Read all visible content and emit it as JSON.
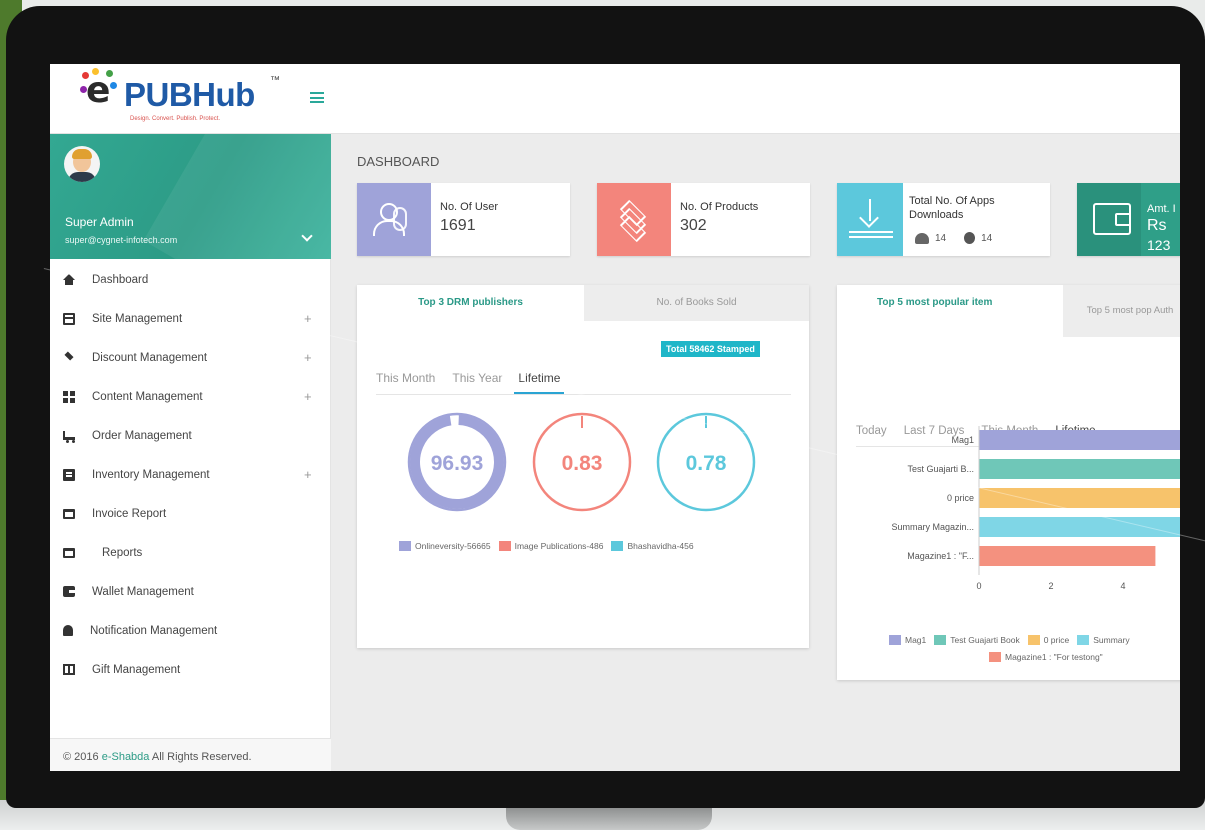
{
  "brand": {
    "logo_text": "PUBHub",
    "logo_prefix": "e",
    "trademark": "™",
    "tagline": "Design. Convert. Publish. Protect."
  },
  "user": {
    "name": "Super Admin",
    "email": "super@cygnet-infotech.com"
  },
  "sidebar": {
    "items": [
      {
        "label": "Dashboard",
        "icon": "home-icon",
        "expandable": false
      },
      {
        "label": "Site Management",
        "icon": "window-icon",
        "expandable": true
      },
      {
        "label": "Discount Management",
        "icon": "layers-icon",
        "expandable": true
      },
      {
        "label": "Content Management",
        "icon": "grid-icon",
        "expandable": true
      },
      {
        "label": "Order Management",
        "icon": "cart-icon",
        "expandable": false
      },
      {
        "label": "Inventory Management",
        "icon": "document-icon",
        "expandable": true
      },
      {
        "label": "Invoice Report",
        "icon": "folder-icon",
        "expandable": false
      },
      {
        "label": "Reports",
        "icon": "folder-icon",
        "expandable": false
      },
      {
        "label": "Wallet Management",
        "icon": "wallet-icon",
        "expandable": false
      },
      {
        "label": "Notification Management",
        "icon": "bell-icon",
        "expandable": false
      },
      {
        "label": "Gift Management",
        "icon": "gift-icon",
        "expandable": false
      }
    ],
    "expand_symbol": "+"
  },
  "footer": {
    "prefix": "© 2016 ",
    "brand": "e-Shabda",
    "suffix": " All Rights Reserved."
  },
  "page": {
    "title": "DASHBOARD"
  },
  "stats": [
    {
      "label": "No. Of User",
      "value": "1691",
      "color": "#9fa3d9",
      "icon": "users-icon"
    },
    {
      "label": "No. Of Products",
      "value": "302",
      "color": "#f3857c",
      "icon": "layers-icon"
    },
    {
      "label": "Total No. Of Apps Downloads",
      "android": "14",
      "ios": "14",
      "color": "#5cc8dc",
      "icon": "download-icon"
    },
    {
      "label": "Amt. I",
      "currency": "Rs",
      "value": "123",
      "color": "#2f9f88",
      "icon": "wallet-icon"
    }
  ],
  "drm_panel": {
    "tabs": [
      "Top 3 DRM publishers",
      "No. of Books Sold"
    ],
    "badge": "Total 58462 Stamped",
    "time_tabs": [
      "This Month",
      "This Year",
      "Lifetime"
    ],
    "selected_time": "Lifetime",
    "donuts": [
      {
        "value": "96.93",
        "fraction": 0.9693,
        "color": "#9fa3d9"
      },
      {
        "value": "0.83",
        "fraction": 0.0083,
        "color": "#f3857c"
      },
      {
        "value": "0.78",
        "fraction": 0.0078,
        "color": "#5cc8dc"
      }
    ],
    "legend": [
      {
        "label": "Onlineversity-56665",
        "color": "#9fa3d9"
      },
      {
        "label": "Image Publications-486",
        "color": "#f3857c"
      },
      {
        "label": "Bhashavidha-456",
        "color": "#5cc8dc"
      }
    ]
  },
  "popular_panel": {
    "tabs": [
      "Top 5 most popular item",
      "Top 5 most pop Auth"
    ],
    "time_tabs": [
      "Today",
      "Last 7 Days",
      "This Month",
      "Lifetime"
    ],
    "selected_time": "Lifetime",
    "legend": [
      {
        "label": "Mag1",
        "color": "#9fa3d9"
      },
      {
        "label": "Test Guajarti Book",
        "color": "#6fc7b8"
      },
      {
        "label": "0 price",
        "color": "#f7c36b"
      },
      {
        "label": "Summary",
        "color": "#7fd6e6"
      },
      {
        "label": "Magazine1 : \"For testong\"",
        "color": "#f4917f"
      }
    ]
  },
  "chart_data": {
    "type": "bar",
    "orientation": "horizontal",
    "categories": [
      "Mag1",
      "Test Guajarti B...",
      "0 price",
      "Summary Magazin...",
      "Magazine1 : \"F..."
    ],
    "values": [
      9,
      9,
      9,
      9,
      4.9
    ],
    "colors": [
      "#9fa3d9",
      "#6fc7b8",
      "#f7c36b",
      "#7fd6e6",
      "#f4917f"
    ],
    "xticks": [
      0,
      2,
      4
    ],
    "xlim": [
      0,
      5.9
    ],
    "title": "",
    "xlabel": "",
    "ylabel": ""
  }
}
